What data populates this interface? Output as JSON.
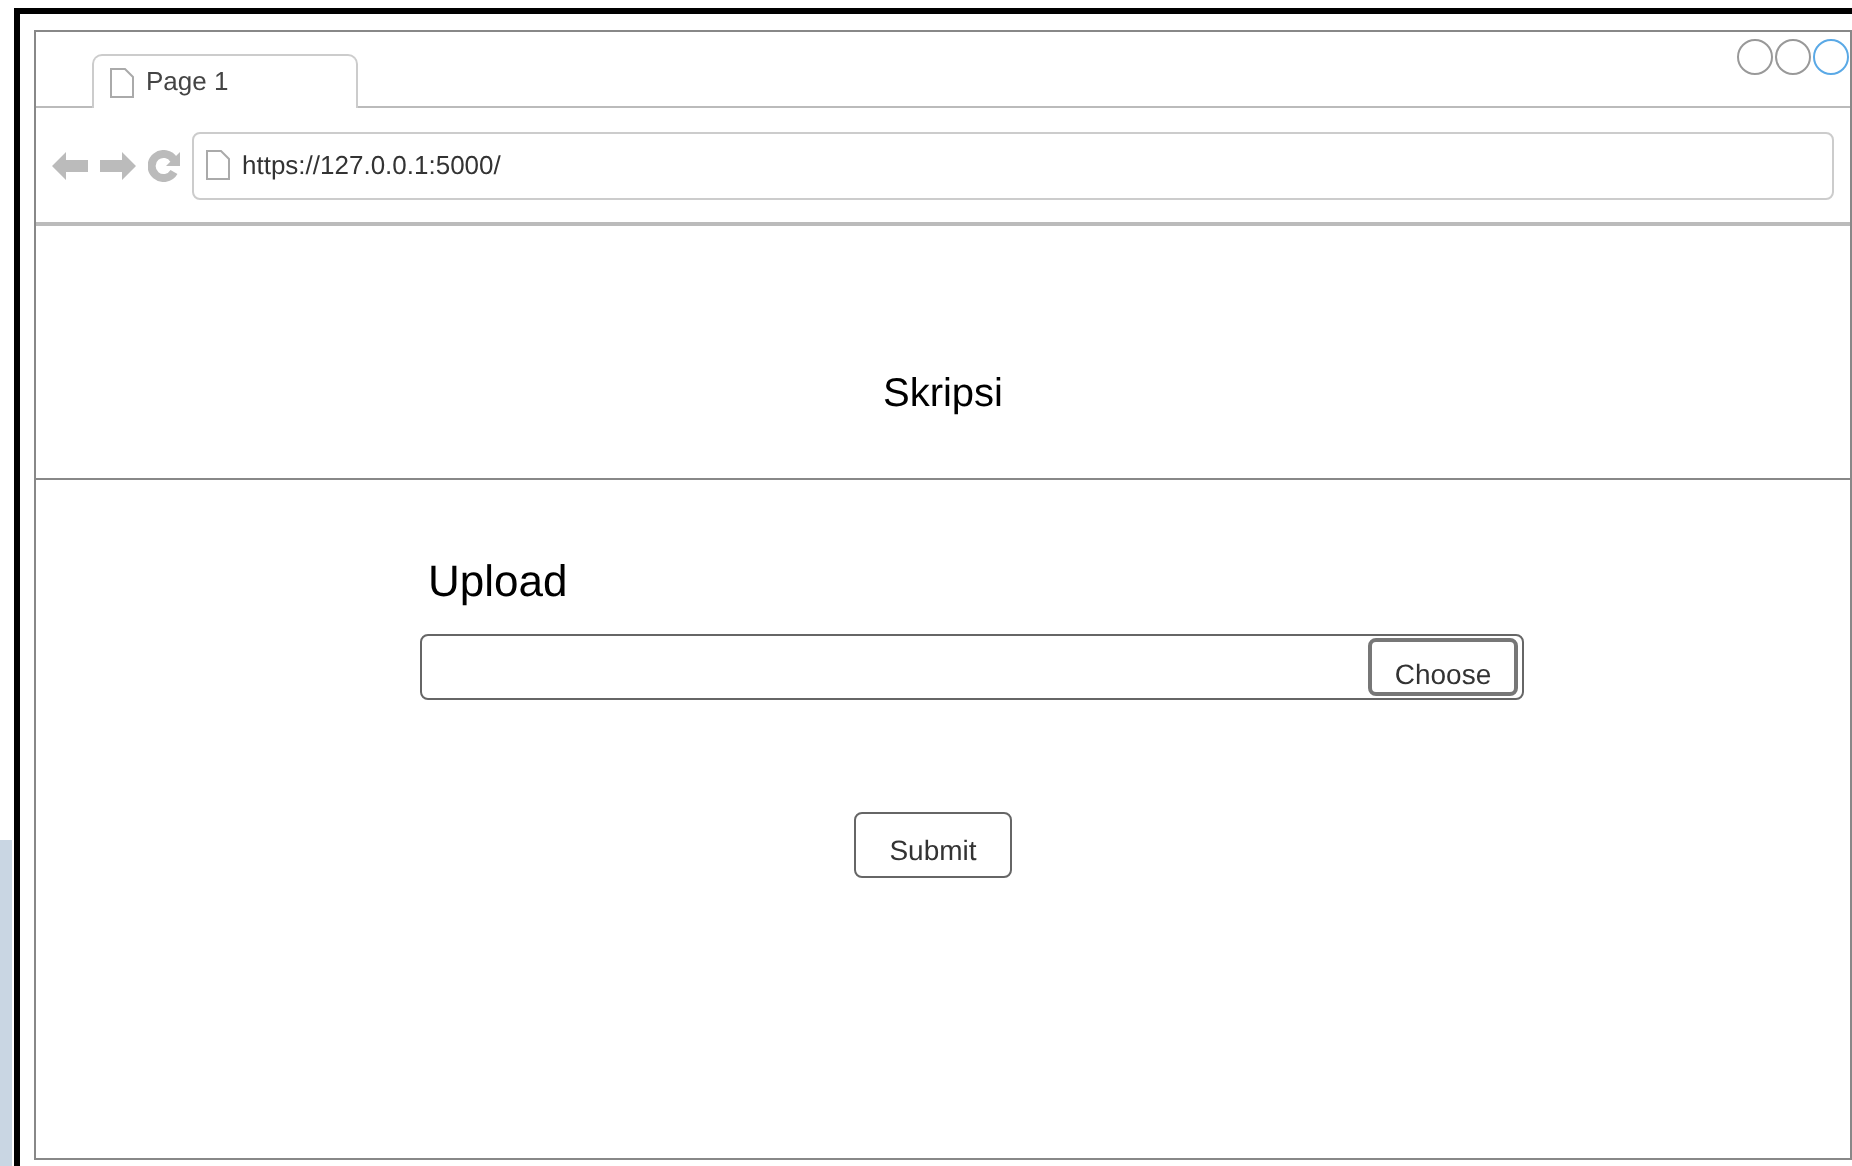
{
  "browser": {
    "tab": {
      "label": "Page 1"
    },
    "address": "https://127.0.0.1:5000/"
  },
  "header": {
    "title": "Skripsi"
  },
  "form": {
    "label": "Upload",
    "choose_button": "Choose",
    "submit_button": "Submit"
  }
}
